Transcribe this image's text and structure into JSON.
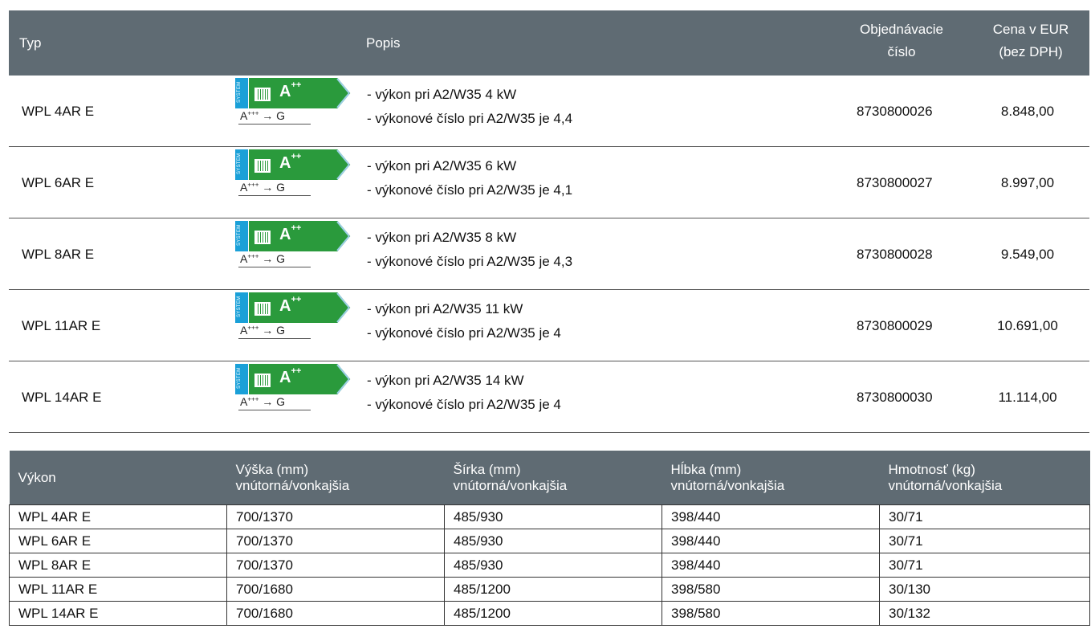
{
  "top_table": {
    "headers": {
      "typ": "Typ",
      "popis": "Popis",
      "objednavacie": [
        "Objednávacie",
        "číslo"
      ],
      "cena": [
        "Cena v EUR",
        "(bez DPH)"
      ]
    },
    "energy_label": {
      "system_text": "SYSTEM",
      "class": "A",
      "class_sup": "++",
      "range_from": "A",
      "range_from_sup": "+++",
      "range_to": "→ G",
      "color": "#2a9a3c",
      "system_color": "#1aa0d8"
    },
    "rows": [
      {
        "typ": "WPL 4AR E",
        "desc1": "- výkon pri A2/W35 4 kW",
        "desc2": "- výkonové číslo pri A2/W35 je 4,4",
        "obj": "8730800026",
        "cena": "8.848,00"
      },
      {
        "typ": "WPL 6AR E",
        "desc1": "- výkon pri A2/W35 6 kW",
        "desc2": "- výkonové číslo pri A2/W35 je 4,1",
        "obj": "8730800027",
        "cena": "8.997,00"
      },
      {
        "typ": "WPL 8AR E",
        "desc1": "- výkon pri A2/W35 8 kW",
        "desc2": "- výkonové číslo pri A2/W35 je 4,3",
        "obj": "8730800028",
        "cena": "9.549,00"
      },
      {
        "typ": "WPL 11AR E",
        "desc1": "- výkon pri A2/W35 11 kW",
        "desc2": "- výkonové číslo pri A2/W35 je 4",
        "obj": "8730800029",
        "cena": "10.691,00"
      },
      {
        "typ": "WPL 14AR E",
        "desc1": "- výkon pri A2/W35 14 kW",
        "desc2": "- výkonové číslo pri A2/W35 je 4",
        "obj": "8730800030",
        "cena": "11.114,00"
      }
    ]
  },
  "dims_table": {
    "headers": [
      {
        "l1": "Výkon",
        "l2": ""
      },
      {
        "l1": "Výška (mm)",
        "l2": "vnútorná/vonkajšia"
      },
      {
        "l1": "Šírka (mm)",
        "l2": "vnútorná/vonkajšia"
      },
      {
        "l1": "Hĺbka (mm)",
        "l2": "vnútorná/vonkajšia"
      },
      {
        "l1": "Hmotnosť (kg)",
        "l2": "vnútorná/vonkajšia"
      }
    ],
    "rows": [
      [
        "WPL 4AR E",
        "700/1370",
        "485/930",
        "398/440",
        "30/71"
      ],
      [
        "WPL 6AR E",
        "700/1370",
        "485/930",
        "398/440",
        "30/71"
      ],
      [
        "WPL 8AR E",
        "700/1370",
        "485/930",
        "398/440",
        "30/71"
      ],
      [
        "WPL 11AR E",
        "700/1680",
        "485/1200",
        "398/580",
        "30/130"
      ],
      [
        "WPL 14AR E",
        "700/1680",
        "485/1200",
        "398/580",
        "30/132"
      ]
    ]
  }
}
